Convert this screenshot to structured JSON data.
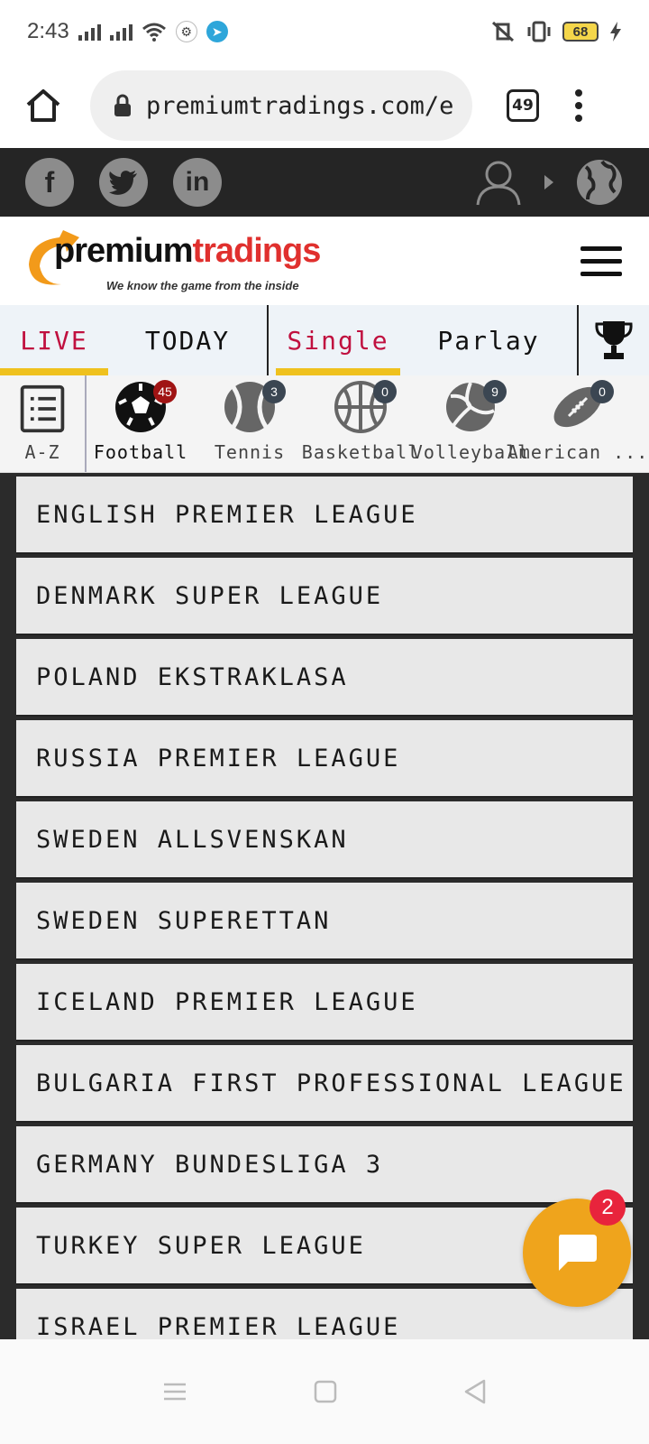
{
  "status_bar": {
    "time": "2:43",
    "battery": "68"
  },
  "browser": {
    "url": "premiumtradings.com/e",
    "tab_count": "49"
  },
  "social": {
    "facebook_label": "f",
    "linkedin_label": "in"
  },
  "logo": {
    "part1": "premium",
    "part2": "tradings",
    "tagline": "We know the game from the inside"
  },
  "tabs": [
    {
      "label": "LIVE",
      "active": true
    },
    {
      "label": "TODAY",
      "active": false
    },
    {
      "label": "Single",
      "active": true
    },
    {
      "label": "Parlay",
      "active": false
    }
  ],
  "sports": [
    {
      "label": "A-Z",
      "icon": "list-icon"
    },
    {
      "label": "Football",
      "count": "45",
      "icon": "soccer-ball-icon",
      "active": true
    },
    {
      "label": "Tennis",
      "count": "3",
      "icon": "tennis-ball-icon"
    },
    {
      "label": "Basketball",
      "count": "0",
      "icon": "basketball-icon"
    },
    {
      "label": "Volleyball",
      "count": "9",
      "icon": "volleyball-icon"
    },
    {
      "label": "American ...",
      "count": "0",
      "icon": "american-football-icon"
    }
  ],
  "leagues": [
    "ENGLISH PREMIER LEAGUE",
    "DENMARK SUPER LEAGUE",
    "POLAND EKSTRAKLASA",
    "RUSSIA PREMIER LEAGUE",
    "SWEDEN ALLSVENSKAN",
    "SWEDEN SUPERETTAN",
    "ICELAND PREMIER LEAGUE",
    "BULGARIA FIRST PROFESSIONAL LEAGUE",
    "GERMANY BUNDESLIGA 3",
    "TURKEY SUPER LEAGUE",
    "ISRAEL PREMIER LEAGUE"
  ],
  "chat": {
    "unread": "2"
  },
  "colors": {
    "accent_red": "#c0103f",
    "underline_yellow": "#efc11e",
    "chat_orange": "#efa41c",
    "dark_bar": "#252525"
  }
}
